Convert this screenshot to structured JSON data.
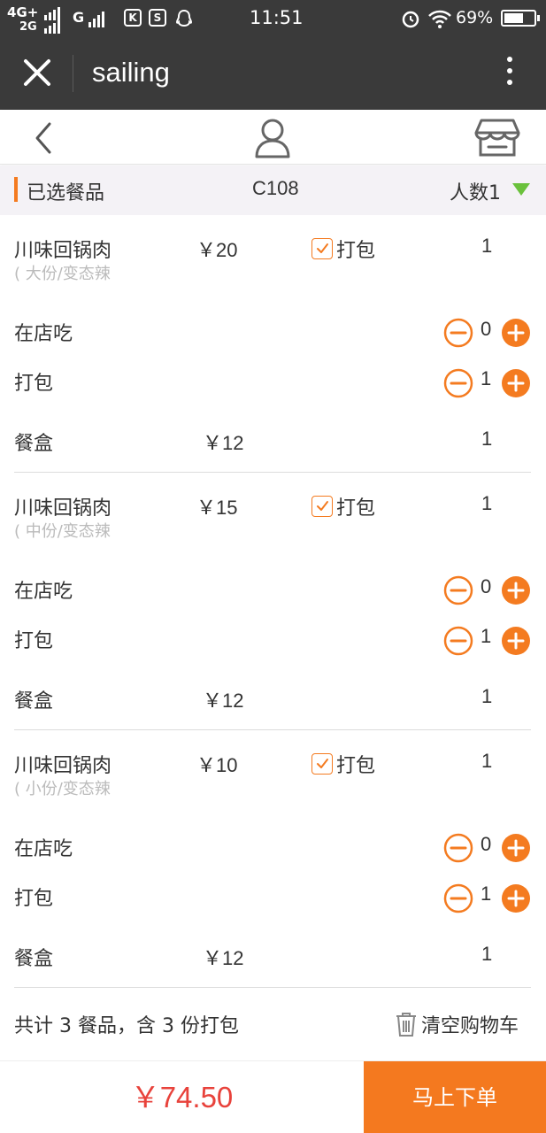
{
  "status_bar": {
    "network_top": "4G+",
    "network_bottom": "2G",
    "network_second": "G",
    "time": "11:51",
    "battery": "69%",
    "battery_level": 0.69
  },
  "title_bar": {
    "title": "sailing"
  },
  "header": {
    "label": "已选餐品",
    "table": "C108",
    "people": "人数1"
  },
  "items": [
    {
      "name": "川味回锅肉",
      "spec": "( 大份/变态辣",
      "price": "￥20",
      "pack_label": "打包",
      "pack_checked": true,
      "qty": "1",
      "dine_in_label": "在店吃",
      "dine_in_count": "0",
      "takeaway_label": "打包",
      "takeaway_count": "1",
      "box_label": "餐盒",
      "box_price": "￥12",
      "box_qty": "1"
    },
    {
      "name": "川味回锅肉",
      "spec": "( 中份/变态辣",
      "price": "￥15",
      "pack_label": "打包",
      "pack_checked": true,
      "qty": "1",
      "dine_in_label": "在店吃",
      "dine_in_count": "0",
      "takeaway_label": "打包",
      "takeaway_count": "1",
      "box_label": "餐盒",
      "box_price": "￥12",
      "box_qty": "1"
    },
    {
      "name": "川味回锅肉",
      "spec": "( 小份/变态辣",
      "price": "￥10",
      "pack_label": "打包",
      "pack_checked": true,
      "qty": "1",
      "dine_in_label": "在店吃",
      "dine_in_count": "0",
      "takeaway_label": "打包",
      "takeaway_count": "1",
      "box_label": "餐盒",
      "box_price": "￥12",
      "box_qty": "1"
    }
  ],
  "summary": {
    "text": "共计 3 餐品，含 3 份打包",
    "clear_label": "清空购物车"
  },
  "footer": {
    "total": "￥74.50",
    "order_label": "马上下单"
  },
  "colors": {
    "accent": "#f4791f",
    "price_red": "#e8423b",
    "dark_bar": "#3a3a3a",
    "indicator_green": "#6ac13c"
  },
  "icons": [
    "close-icon",
    "more-icon",
    "back-icon",
    "user-icon",
    "shop-icon",
    "dropdown-triangle-icon",
    "check-icon",
    "minus-icon",
    "plus-icon",
    "trash-icon",
    "alarm-icon",
    "wifi-icon",
    "battery-icon"
  ]
}
